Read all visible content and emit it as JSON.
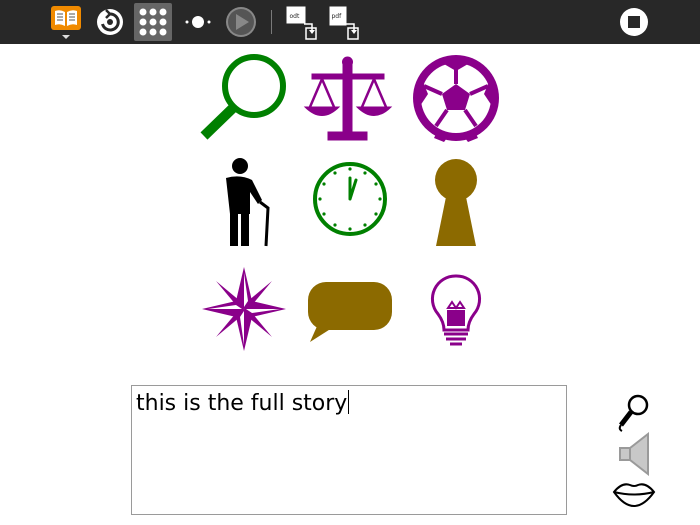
{
  "toolbar": {
    "items": [
      {
        "name": "activity-icon"
      },
      {
        "name": "share-icon"
      },
      {
        "name": "story-grid-icon"
      },
      {
        "name": "dot-icon"
      },
      {
        "name": "play-icon"
      },
      {
        "name": "save-as-odt-icon"
      },
      {
        "name": "save-as-pdf-icon"
      },
      {
        "name": "stop-icon"
      }
    ],
    "odt_label": "odt",
    "pdf_label": "pdf"
  },
  "cards": [
    {
      "name": "magnifier-icon",
      "color": "#008000"
    },
    {
      "name": "scales-icon",
      "color": "#8a008a"
    },
    {
      "name": "soccer-ball-icon",
      "color": "#8a008a"
    },
    {
      "name": "old-man-with-cane-icon",
      "color": "#000000"
    },
    {
      "name": "clock-icon",
      "color": "#008000"
    },
    {
      "name": "keyhole-icon",
      "color": "#8c6a00"
    },
    {
      "name": "compass-rose-icon",
      "color": "#8a008a"
    },
    {
      "name": "speech-bubble-icon",
      "color": "#8c6a00"
    },
    {
      "name": "light-bulb-icon",
      "color": "#8a008a"
    }
  ],
  "story": {
    "text": "this is the full story"
  },
  "side_buttons": [
    {
      "name": "microphone-icon"
    },
    {
      "name": "speaker-icon"
    },
    {
      "name": "lips-icon"
    }
  ]
}
